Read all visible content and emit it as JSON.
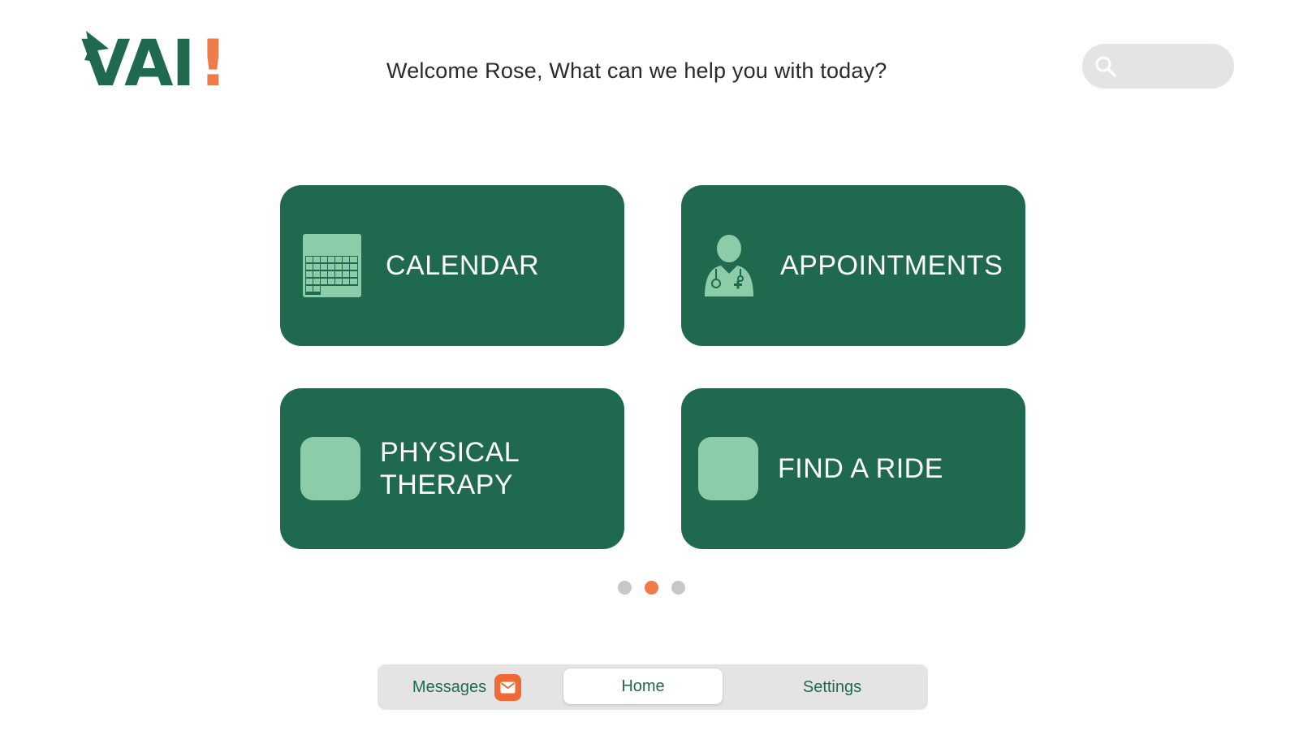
{
  "app": {
    "logo_text": "VAI",
    "logo_bang": "!"
  },
  "header": {
    "welcome": "Welcome Rose, What can we help you with today?"
  },
  "search": {
    "placeholder": "",
    "icon": "search-icon"
  },
  "tiles": [
    {
      "label": "CALENDAR",
      "icon": "calendar-icon"
    },
    {
      "label": "APPOINTMENTS",
      "icon": "doctor-icon"
    },
    {
      "label_line1": "PHYSICAL",
      "label_line2": "THERAPY",
      "icon": "placeholder-icon"
    },
    {
      "label": "FIND A RIDE",
      "icon": "placeholder-icon"
    }
  ],
  "pagination": {
    "pages": 3,
    "active": 2
  },
  "nav": {
    "messages": "Messages",
    "home": "Home",
    "settings": "Settings",
    "active": "Home"
  },
  "colors": {
    "brand_green": "#1f6a4e",
    "accent_orange": "#ef7a4a",
    "icon_light_green": "#8ccca8",
    "neutral_gray": "#e4e4e4"
  }
}
